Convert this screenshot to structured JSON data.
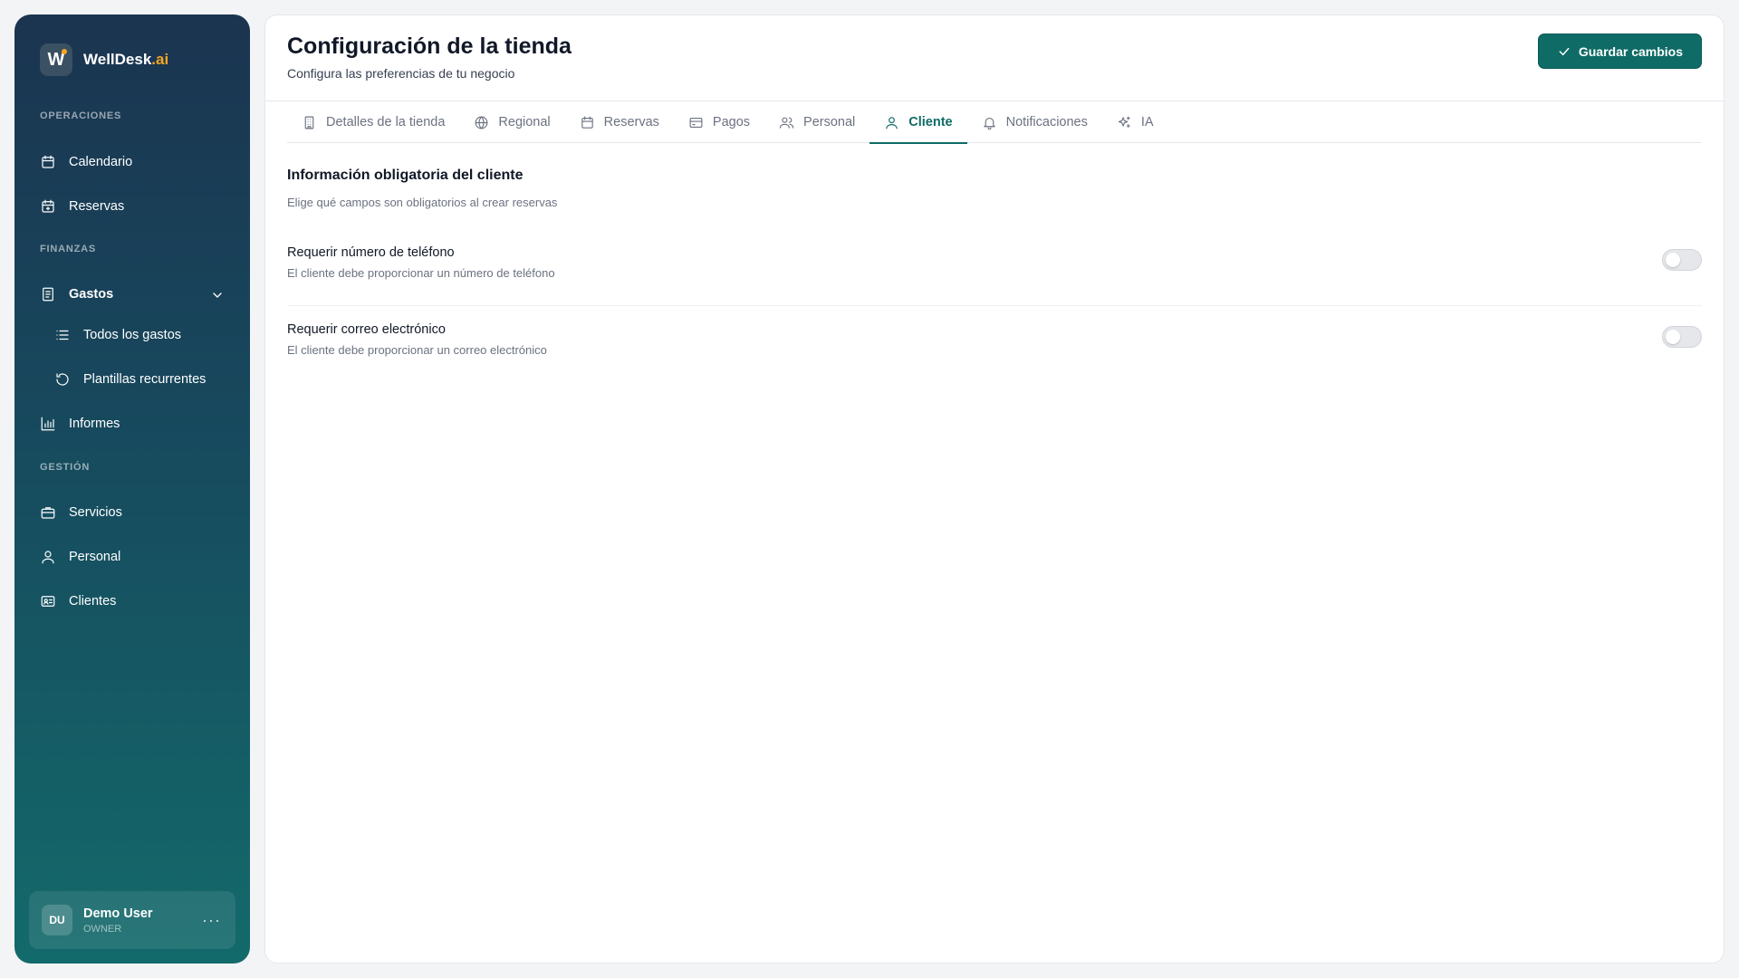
{
  "sidebar": {
    "brand": {
      "logo_letter": "W",
      "name": "WellDesk",
      "suffix": ".ai"
    },
    "sections": {
      "operaciones": "OPERACIONES",
      "finanzas": "FINANZAS",
      "gestion": "GESTIÓN"
    },
    "items": {
      "calendario": "Calendario",
      "reservas": "Reservas",
      "gastos": "Gastos",
      "todos_gastos": "Todos los gastos",
      "plantillas": "Plantillas recurrentes",
      "informes": "Informes",
      "servicios": "Servicios",
      "personal": "Personal",
      "clientes": "Clientes"
    },
    "user": {
      "initials": "DU",
      "name": "Demo User",
      "role": "OWNER",
      "more": "···"
    }
  },
  "header": {
    "title": "Configuración de la tienda",
    "subtitle": "Configura las preferencias de tu negocio",
    "save_label": "Guardar cambios"
  },
  "tabs": [
    {
      "label": "Detalles de la tienda",
      "icon": "building-icon",
      "active": false
    },
    {
      "label": "Regional",
      "icon": "globe-icon",
      "active": false
    },
    {
      "label": "Reservas",
      "icon": "calendar-icon",
      "active": false
    },
    {
      "label": "Pagos",
      "icon": "credit-card-icon",
      "active": false
    },
    {
      "label": "Personal",
      "icon": "users-icon",
      "active": false
    },
    {
      "label": "Cliente",
      "icon": "user-icon",
      "active": true
    },
    {
      "label": "Notificaciones",
      "icon": "bell-icon",
      "active": false
    },
    {
      "label": "IA",
      "icon": "sparkles-icon",
      "active": false
    }
  ],
  "content": {
    "section_title": "Información obligatoria del cliente",
    "section_desc": "Elige qué campos son obligatorios al crear reservas",
    "settings": [
      {
        "title": "Requerir número de teléfono",
        "desc": "El cliente debe proporcionar un número de teléfono",
        "enabled": false
      },
      {
        "title": "Requerir correo electrónico",
        "desc": "El cliente debe proporcionar un correo electrónico",
        "enabled": false
      }
    ]
  },
  "colors": {
    "accent": "#0f6b66",
    "brand_highlight": "#f5a623"
  }
}
